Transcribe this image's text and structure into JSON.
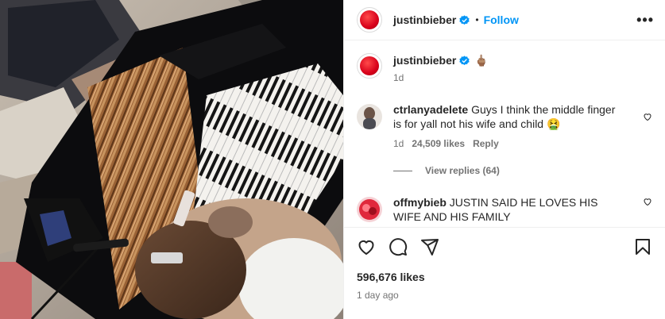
{
  "post": {
    "username": "justinbieber",
    "follow_label": "Follow",
    "separator": "•",
    "more_label": "•••",
    "caption_emoji": "🖕🏽",
    "caption_age": "1d",
    "likes": "596,676 likes",
    "time_ago": "1 day ago"
  },
  "comments": [
    {
      "username": "ctrlanyadelete",
      "text": "Guys I think the middle finger is for yall not his wife and child 🤮",
      "age": "1d",
      "likes": "24,509 likes",
      "reply_label": "Reply",
      "view_replies": "View replies (64)"
    },
    {
      "username": "offmybieb",
      "text": "JUSTIN SAID HE LOVES HIS WIFE AND HIS FAMILY"
    }
  ],
  "icons": {
    "verified": "verified-badge-icon",
    "heart": "heart-icon",
    "comment": "comment-icon",
    "share": "share-icon",
    "save": "bookmark-icon"
  },
  "colors": {
    "accent": "#0095f6",
    "avatar_red": "#d8001a",
    "muted": "#737373"
  }
}
